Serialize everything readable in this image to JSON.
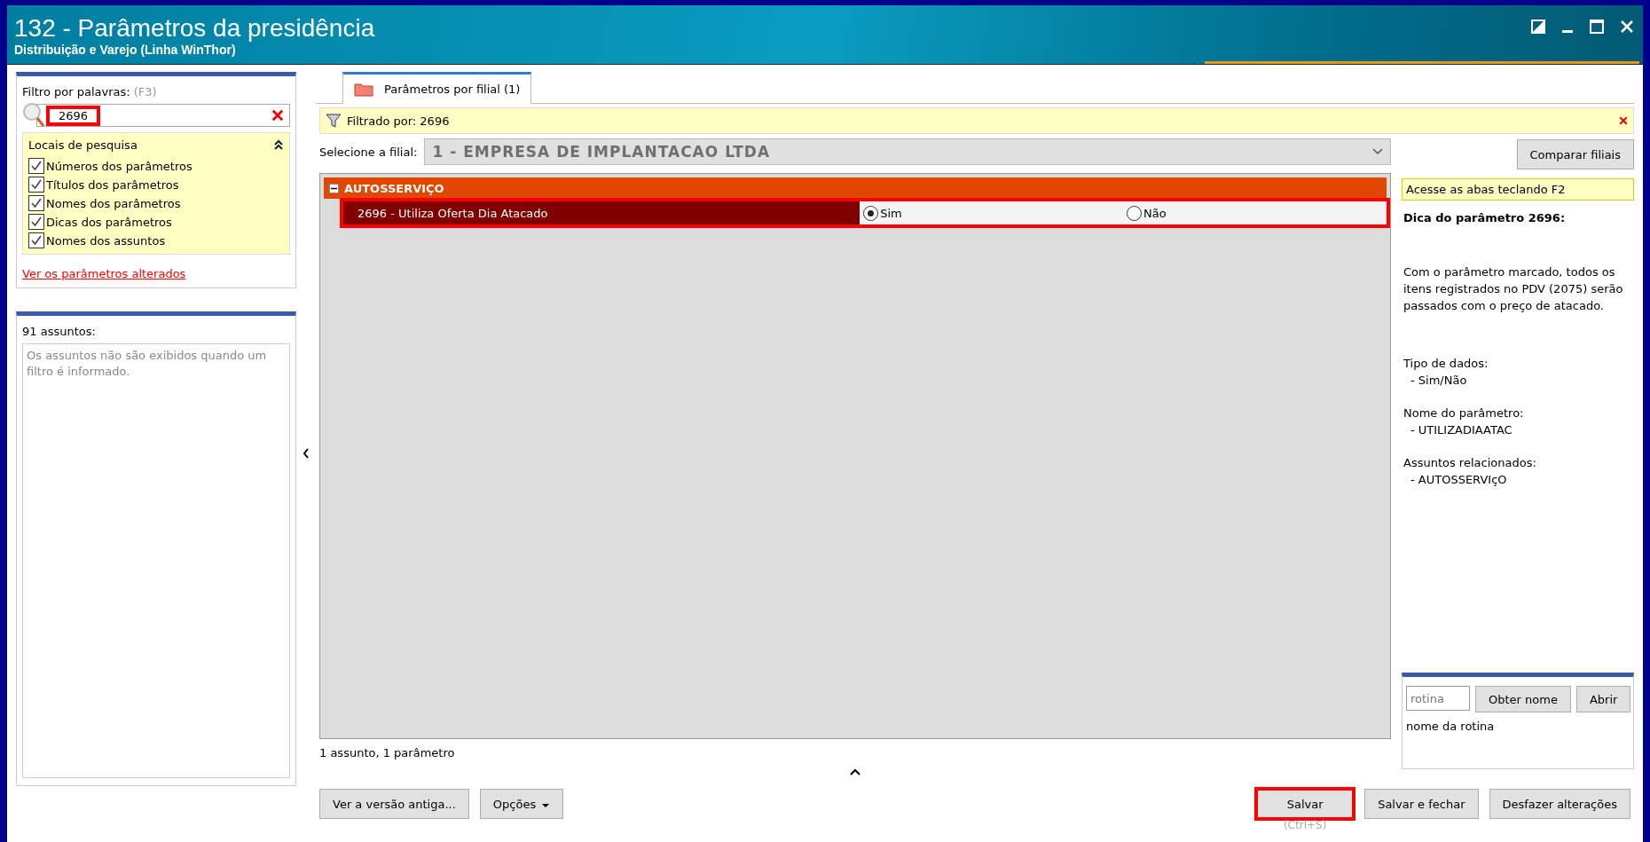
{
  "window": {
    "title": "132 - Parâmetros da presidência",
    "subtitle": "Distribuição e Varejo (Linha WinThor)"
  },
  "filter": {
    "label": "Filtro por palavras:",
    "shortcut": "(F3)",
    "value": "2696",
    "highlighted": true
  },
  "search_locations": {
    "title": "Locais de pesquisa",
    "expanded": true,
    "items": [
      {
        "label": "Números dos parâmetros",
        "checked": true
      },
      {
        "label": "Títulos dos parâmetros",
        "checked": true
      },
      {
        "label": "Nomes dos parâmetros",
        "checked": true
      },
      {
        "label": "Dicas dos parâmetros",
        "checked": true
      },
      {
        "label": "Nomes dos assuntos",
        "checked": true
      }
    ]
  },
  "changed_link": "Ver os parâmetros alterados",
  "subjects": {
    "title": "91 assuntos:",
    "note": "Os assuntos não são exibidos quando um filtro é informado."
  },
  "tabs": [
    {
      "label": "Parâmetros por filial  (1)",
      "selected": true
    }
  ],
  "filter_bar": {
    "text": "Filtrado por: 2696"
  },
  "branch": {
    "label": "Selecione a filial:",
    "value": "1 - EMPRESA DE IMPLANTACAO LTDA",
    "disabled": true
  },
  "compare_button": "Comparar filiais",
  "groups": [
    {
      "title": "AUTOSSERVIÇO",
      "expanded": true,
      "params": [
        {
          "label": "2696 - Utiliza Oferta Dia Atacado",
          "highlighted": true,
          "options": [
            {
              "label": "Sim",
              "selected": true
            },
            {
              "label": "Não",
              "selected": false
            }
          ]
        }
      ]
    }
  ],
  "status": "1 assunto, 1 parâmetro",
  "tip": {
    "banner": "Acesse as abas teclando F2",
    "title": "Dica do parâmetro 2696:",
    "text": "Com o parâmetro marcado, todos os itens registrados no PDV (2075) serão passados com o preço de atacado.",
    "sections": [
      {
        "heading": "Tipo de dados:",
        "value": "- Sim/Não"
      },
      {
        "heading": "Nome do parâmetro:",
        "value": "- UTILIZADIAATAC"
      },
      {
        "heading": "Assuntos relacionados:",
        "value": "- AUTOSSERVIçO"
      }
    ]
  },
  "routine": {
    "placeholder": "rotina",
    "buttons": [
      "Obter nome",
      "Abrir"
    ],
    "caption": "nome da rotina"
  },
  "footer_left": [
    {
      "label": "Ver a versão antiga...",
      "kind": "plain"
    },
    {
      "label": "Opções",
      "kind": "dropdown"
    }
  ],
  "footer_right": [
    {
      "label": "Salvar",
      "highlighted": true,
      "hint": "(Ctrl+S)"
    },
    {
      "label": "Salvar e fechar",
      "highlighted": false
    },
    {
      "label": "Desfazer alterações",
      "highlighted": false
    }
  ]
}
